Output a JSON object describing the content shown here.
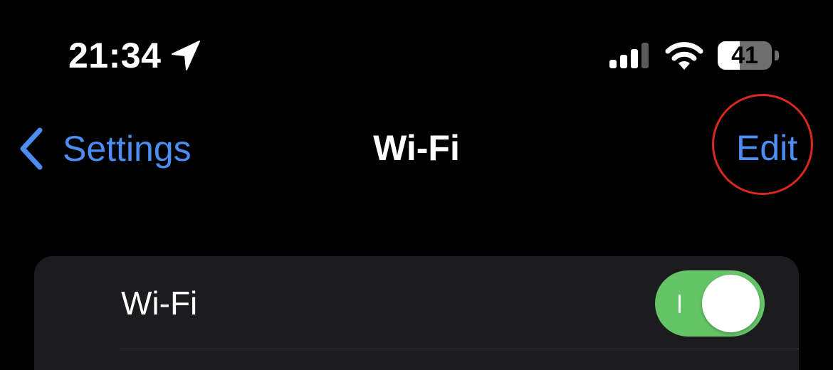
{
  "status_bar": {
    "time": "21:34",
    "location_icon": "location-arrow-icon",
    "signal_icon": "cellular-signal-icon",
    "wifi_icon": "wifi-icon",
    "battery_level": "41",
    "battery_fraction": 0.41
  },
  "nav": {
    "back_label": "Settings",
    "back_icon": "chevron-left-icon",
    "title": "Wi-Fi",
    "edit_label": "Edit",
    "accent_color": "#4b8df2",
    "highlight_color": "#d8281f"
  },
  "wifi_group": {
    "wifi_label": "Wi-Fi",
    "wifi_toggle_on": true,
    "toggle_color": "#65c466"
  }
}
